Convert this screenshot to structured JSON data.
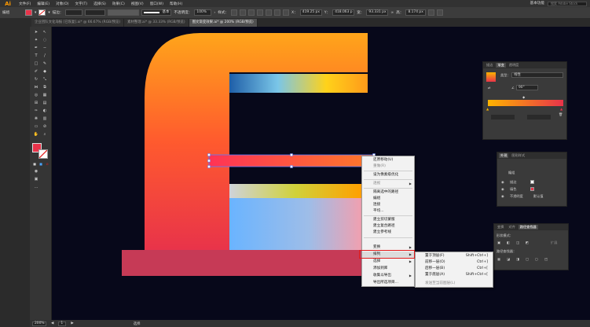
{
  "app": {
    "logo": "Ai"
  },
  "menubar": {
    "items": [
      "文件(F)",
      "编辑(E)",
      "对象(O)",
      "文字(T)",
      "选择(S)",
      "效果(C)",
      "视图(V)",
      "窗口(W)",
      "帮助(H)"
    ],
    "workspace": "基本功能",
    "search_placeholder": "搜索 Adobe Stock"
  },
  "controlbar": {
    "selection_label": "编组",
    "stroke_label": "描边：",
    "stroke_style": "基本",
    "opacity_label": "不透明度：",
    "opacity_value": "100%",
    "style_label": "样式：",
    "x_label": "X：",
    "x_value": "419.25 px",
    "y_label": "Y：",
    "y_value": "418.063 p",
    "w_label": "宽：",
    "w_value": "93.331 px",
    "h_label": "高：",
    "h_value": "8.174 px",
    "colors": {
      "fill": "#e8334a",
      "stroke": "#ffffff"
    }
  },
  "tabs": [
    {
      "label": "企业团队文化海报 [已恢复].ai* @ 66.67% (RGB/预览)",
      "active": false
    },
    {
      "label": "素材整理.ai* @ 33.33% (RGB/预览)",
      "active": false
    },
    {
      "label": "图文渐变效果.ai* @ 200% (RGB/预览)",
      "active": true
    }
  ],
  "statusbar": {
    "zoom": "200%",
    "page": "1",
    "tool": "选择"
  },
  "gradient_panel": {
    "tabs": [
      "描边",
      "渐变",
      "透明度"
    ],
    "type_label": "类型：",
    "type_value": "线性",
    "angle_value": "90°",
    "colors": {
      "start": "#ffb400",
      "end": "#e8334a"
    }
  },
  "layers_panel": {
    "tabs": [
      "外观",
      "图形样式"
    ],
    "group_label": "编组",
    "stroke_label": "描边",
    "fill_label": "填色",
    "opacity_label": "不透明度",
    "opacity_value": "默认值"
  },
  "pathfinder_panel": {
    "tabs": [
      "变换",
      "对齐",
      "路径查找器"
    ],
    "shape_modes_label": "形状模式：",
    "pathfinders_label": "路径查找器：",
    "expand_label": "扩展"
  },
  "context_menu": {
    "items": [
      {
        "label": "还原移动(U)",
        "disabled": false,
        "submenu": false
      },
      {
        "label": "重做(R)",
        "disabled": true,
        "submenu": false
      },
      {
        "label": "设为像素级优化",
        "disabled": false,
        "submenu": false
      },
      {
        "label": "透视",
        "disabled": true,
        "submenu": true
      },
      {
        "label": "隔离选中的路径",
        "disabled": false,
        "submenu": false
      },
      {
        "label": "编组",
        "disabled": false,
        "submenu": false
      },
      {
        "label": "连接",
        "disabled": false,
        "submenu": false
      },
      {
        "label": "平均...",
        "disabled": false,
        "submenu": false
      },
      {
        "label": "建立剪切蒙版",
        "disabled": false,
        "submenu": false
      },
      {
        "label": "建立复合路径",
        "disabled": false,
        "submenu": false
      },
      {
        "label": "建立参考线",
        "disabled": false,
        "submenu": false
      },
      {
        "label": "变换",
        "disabled": false,
        "submenu": true
      },
      {
        "label": "排列",
        "disabled": false,
        "submenu": true
      },
      {
        "label": "选择",
        "disabled": false,
        "submenu": true
      },
      {
        "label": "添加到库",
        "disabled": false,
        "submenu": false
      },
      {
        "label": "收集以导出",
        "disabled": false,
        "submenu": true
      },
      {
        "label": "导出所选项目...",
        "disabled": false,
        "submenu": false
      }
    ]
  },
  "arrange_submenu": {
    "items": [
      {
        "label": "置于顶层(F)",
        "shortcut": "Shift+Ctrl+]",
        "disabled": false
      },
      {
        "label": "前移一层(O)",
        "shortcut": "Ctrl+]",
        "disabled": false
      },
      {
        "label": "后移一层(B)",
        "shortcut": "Ctrl+[",
        "disabled": false
      },
      {
        "label": "置于底层(A)",
        "shortcut": "Shift+Ctrl+[",
        "disabled": false
      },
      {
        "label": "发送至当前图层(L)",
        "shortcut": "",
        "disabled": true
      }
    ]
  }
}
